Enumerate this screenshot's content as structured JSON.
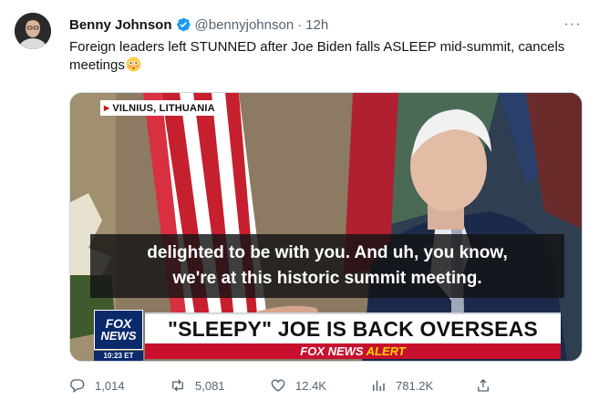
{
  "tweet": {
    "author_name": "Benny Johnson",
    "handle": "@bennyjohnson",
    "separator": "·",
    "time": "12h",
    "text": "Foreign leaders left STUNNED after Joe Biden falls ASLEEP mid-summit, cancels meetings",
    "more_label": "···"
  },
  "media": {
    "location": "VILNIUS, LITHUANIA",
    "caption_line1": "delighted to be with you. And uh, you know,",
    "caption_line2": "we're at this historic summit meeting.",
    "banner": "\"SLEEPY\" JOE IS BACK OVERSEAS",
    "alert_brand": "FOX NEWS",
    "alert_word": "ALERT",
    "logo_line1": "FOX",
    "logo_line2": "NEWS",
    "logo_time": "10:23 ET"
  },
  "actions": {
    "replies": "1,014",
    "retweets": "5,081",
    "likes": "12.4K",
    "views": "781.2K"
  },
  "colors": {
    "text_primary": "#0f1419",
    "text_secondary": "#536471",
    "verified_blue": "#1d9bf0"
  },
  "icons": {
    "verified": "verified-badge-icon",
    "reply": "reply-icon",
    "retweet": "retweet-icon",
    "like": "heart-icon",
    "views": "views-icon",
    "share": "share-icon",
    "emoji": "flushed-face-emoji"
  }
}
